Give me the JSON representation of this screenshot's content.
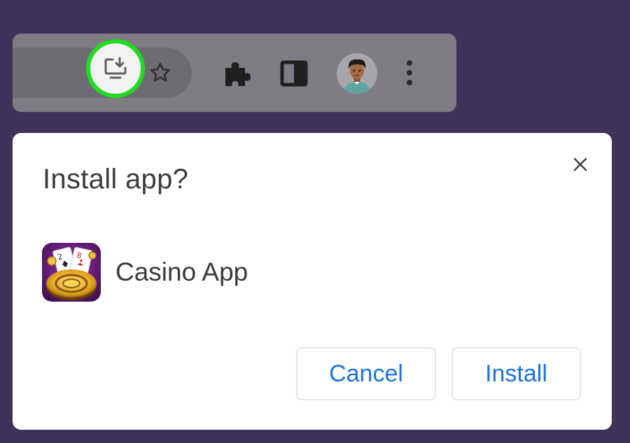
{
  "toolbar": {
    "icons": {
      "install": "install-app-icon",
      "bookmark": "star-icon",
      "extensions": "puzzle-icon",
      "side_panel": "side-panel-icon",
      "profile": "avatar",
      "menu": "kebab-menu-icon"
    },
    "highlight_color": "#1fdc1f"
  },
  "dialog": {
    "title": "Install app?",
    "close_icon": "close-icon",
    "app": {
      "name": "Casino App",
      "icon": "casino-app-icon"
    },
    "buttons": {
      "cancel": "Cancel",
      "install": "Install"
    },
    "accent_color": "#1a73e8"
  },
  "colors": {
    "background": "#3f3359",
    "toolbar": "#7f7d83",
    "dialog": "#ffffff"
  }
}
